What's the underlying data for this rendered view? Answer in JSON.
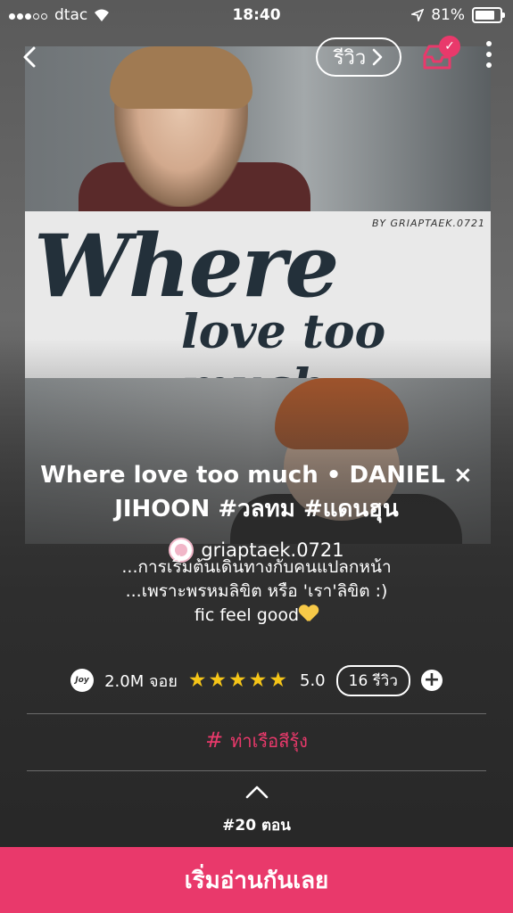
{
  "status_bar": {
    "carrier": "dtac",
    "time": "18:40",
    "battery": "81%",
    "battery_level": 0.81
  },
  "nav": {
    "review_label": "รีวิว"
  },
  "cover": {
    "art_line1": "Where",
    "art_line2": "love too much",
    "byline": "BY GRIAPTAEK.0721"
  },
  "story": {
    "title": "Where love too much • DANIEL × JIHOON #วลทม #แดนฮุน",
    "author": "griaptaek.0721",
    "description": [
      "...การเริ่มต้นเดินทางกับคนแปลกหน้า",
      "...เพราะพรหมลิขิต หรือ 'เรา'ลิขิต :)",
      "fic feel good"
    ]
  },
  "stats": {
    "joy_icon_label": "Joy",
    "views": "2.0M จอย",
    "rating": "5.0",
    "rating_value": 5,
    "reviews": "16 รีวิว"
  },
  "tag": {
    "symbol": "#",
    "label": "ท่าเรือสีรุ้ง"
  },
  "episodes": "#20 ตอน",
  "cta": {
    "label": "เริ่มอ่านกันเลย"
  },
  "colors": {
    "accent": "#e9396b",
    "star": "#f5c518"
  }
}
